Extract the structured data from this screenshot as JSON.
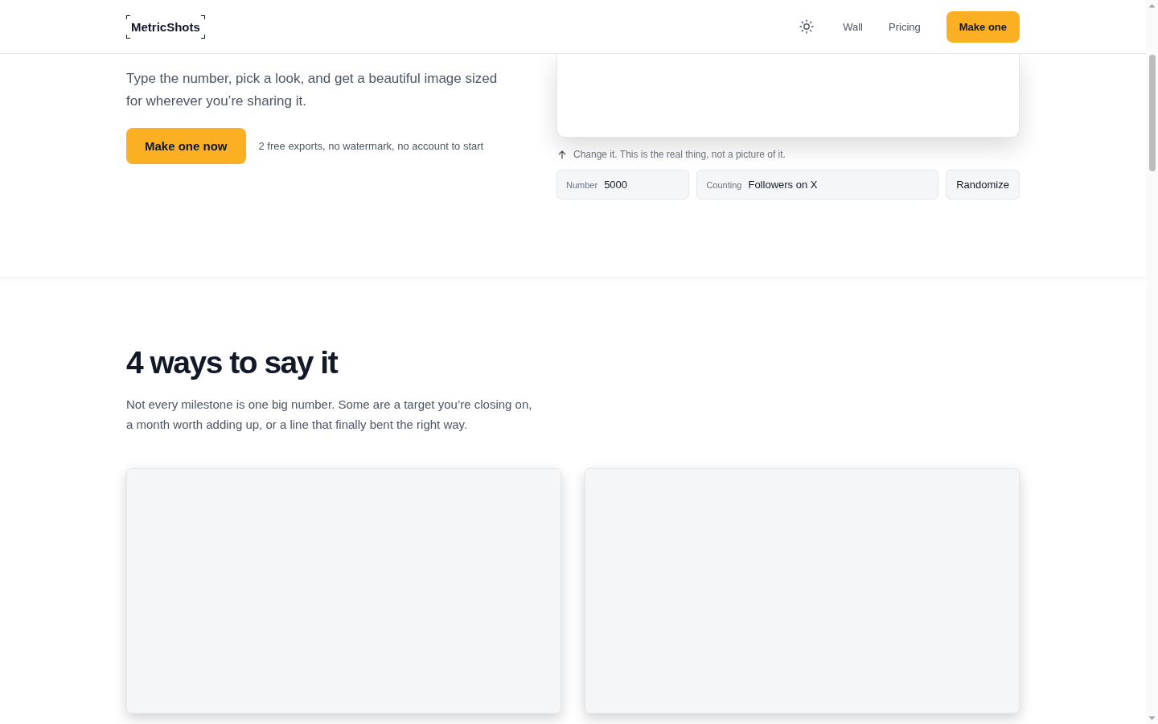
{
  "header": {
    "logo": "MetricShots",
    "nav": [
      {
        "label": "Wall"
      },
      {
        "label": "Pricing"
      }
    ],
    "cta": "Make one"
  },
  "hero": {
    "lede": "Type the number, pick a look, and get a beautiful image sized for wherever you’re sharing it.",
    "cta": "Make one now",
    "note": "2 free exports, no watermark, no account to start",
    "hint": "Change it. This is the real thing, not a picture of it.",
    "fields": [
      {
        "label": "Number",
        "value": "5000"
      },
      {
        "label": "Counting",
        "value": "Followers on X"
      }
    ],
    "randomize": "Randomize"
  },
  "ways": {
    "title": "4 ways to say it",
    "text": "Not every milestone is one big number. Some are a target you’re closing on, a month worth adding up, or a line that finally bent the right way."
  }
}
